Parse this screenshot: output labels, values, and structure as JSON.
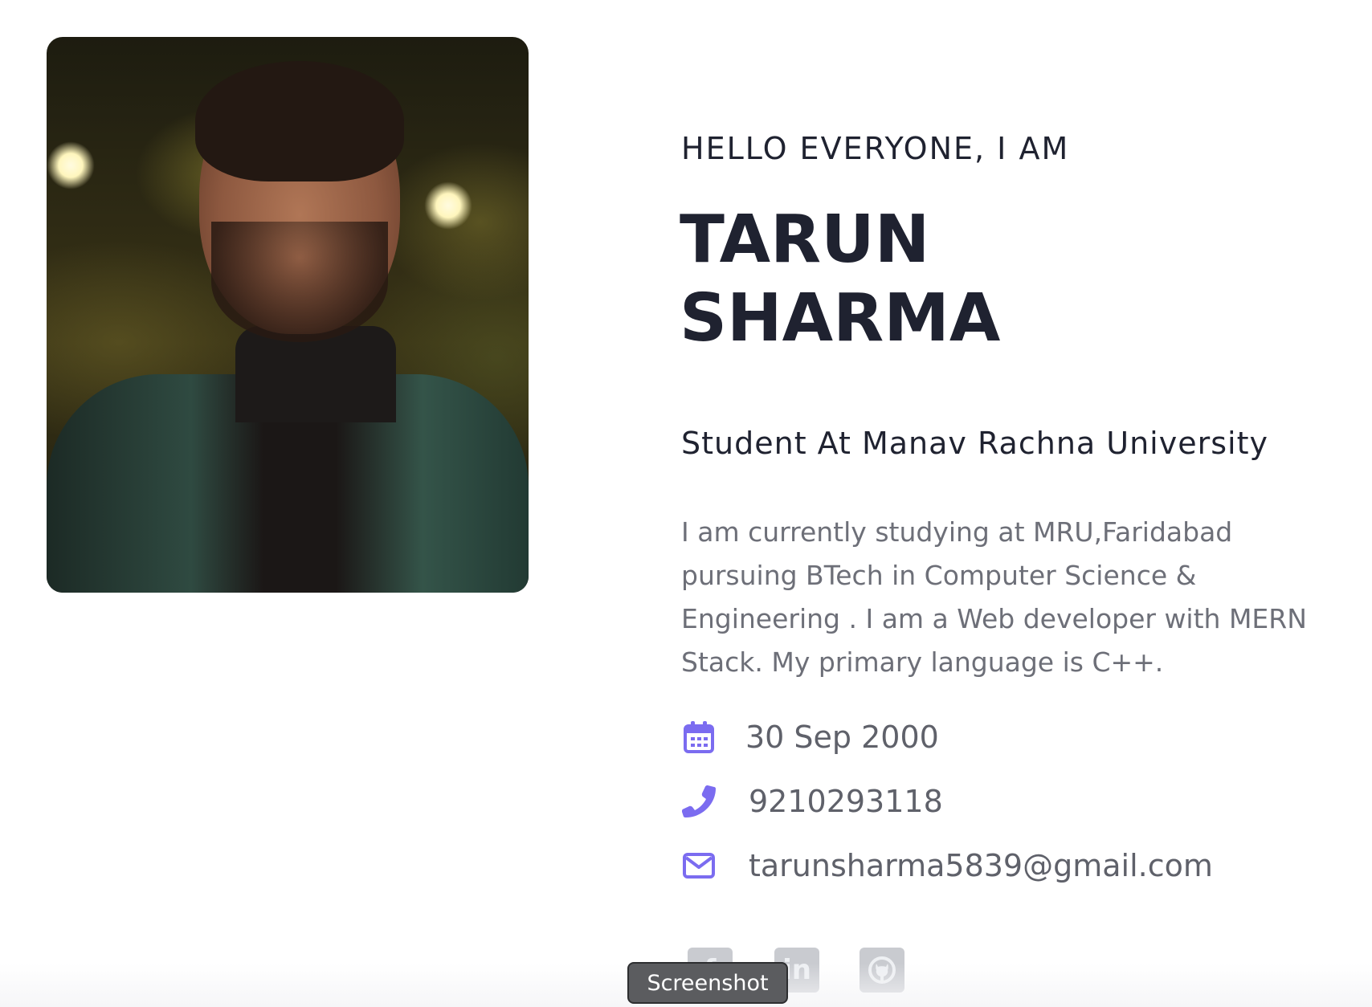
{
  "hero": {
    "greeting": "HELLO EVERYONE, I AM",
    "name_first": "TARUN",
    "name_last": "SHARMA",
    "role": "Student At Manav Rachna University",
    "bio": "I am currently studying at MRU,Faridabad pursuing BTech in Computer Science & Engineering . I am a Web developer with MERN Stack. My primary language is C++."
  },
  "contact": {
    "dob": "30 Sep 2000",
    "phone": "9210293118",
    "email": "tarunsharma5839@gmail.com"
  },
  "social": [
    {
      "icon": "facebook-icon",
      "glyph": "f"
    },
    {
      "icon": "linkedin-icon",
      "glyph": "in"
    },
    {
      "icon": "github-icon",
      "glyph": ""
    }
  ],
  "tooltip": {
    "text": "Screenshot"
  },
  "colors": {
    "accent_icon": "#7b6cf0",
    "heading": "#1f2230",
    "body_text": "#6d6f78",
    "social_icon_bg": "#c9cbd0"
  }
}
